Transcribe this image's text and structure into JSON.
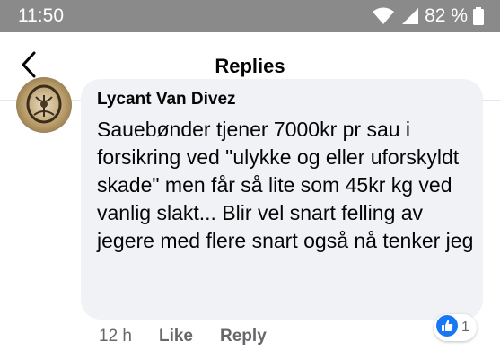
{
  "status_bar": {
    "time": "11:50",
    "battery": "82 %"
  },
  "header": {
    "title": "Replies",
    "back_icon": "chevron-left-icon"
  },
  "comment": {
    "author": "Lycant Van Divez",
    "text": "Sauebønder tjener 7000kr pr sau i forsikring ved \"ulykke og eller uforskyldt skade\" men får så lite som 45kr kg ved vanlig slakt... Blir vel snart felling av jegere med flere snart også nå tenker jeg",
    "time": "12 h",
    "like_label": "Like",
    "reply_label": "Reply",
    "reaction": {
      "icon": "like-icon",
      "count": "1",
      "color": "#1877f2"
    }
  },
  "colors": {
    "status_bar": "#8a8a8a",
    "bubble": "#f0f2f5",
    "muted_text": "#65676b",
    "accent": "#1877f2"
  }
}
